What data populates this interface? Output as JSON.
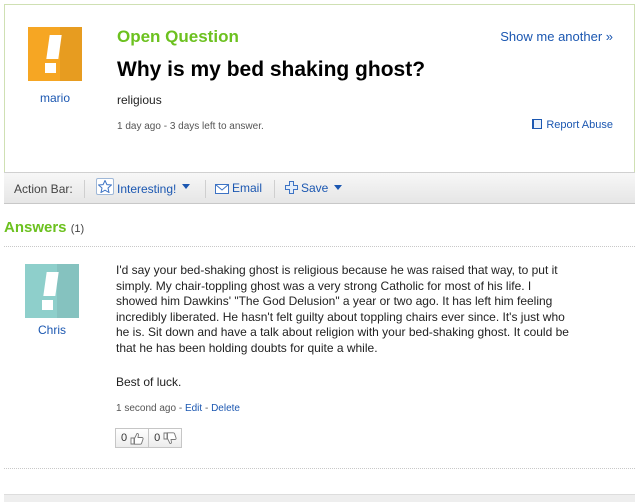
{
  "question": {
    "type_label": "Open Question",
    "show_another": "Show me another »",
    "title": "Why is my bed shaking ghost?",
    "body": "religious",
    "meta": "1 day ago - 3 days left to answer.",
    "report_abuse": "Report Abuse",
    "asker": "mario",
    "asker_avatar_color": "#f6a623"
  },
  "action_bar": {
    "label": "Action Bar:",
    "interesting": "Interesting!",
    "email": "Email",
    "save": "Save"
  },
  "answers": {
    "heading": "Answers",
    "count": "(1)",
    "items": [
      {
        "user": "Chris",
        "avatar_color": "#8ecfcb",
        "lines": [
          "I'd say your bed-shaking ghost is religious because he was raised that way, to put it",
          "simply. My chair-toppling ghost was a very strong Catholic for most of his life. I",
          "showed him Dawkins' \"The God Delusion\" a year or two ago. It has left him feeling",
          "incredibly liberated. He hasn't felt guilty about toppling chairs ever since. It's just who",
          "he is. Sit down and have a talk about religion with your bed-shaking ghost. It could be",
          "that he has been holding doubts for quite a while."
        ],
        "sign_off": "Best of luck.",
        "time": "1 second ago",
        "sep1": " - ",
        "edit": "Edit",
        "sep2": " - ",
        "delete": "Delete",
        "thumbs_up": "0",
        "thumbs_down": "0"
      }
    ]
  },
  "colors": {
    "accent_green": "#6cc11f",
    "link_blue": "#1b57b1"
  }
}
